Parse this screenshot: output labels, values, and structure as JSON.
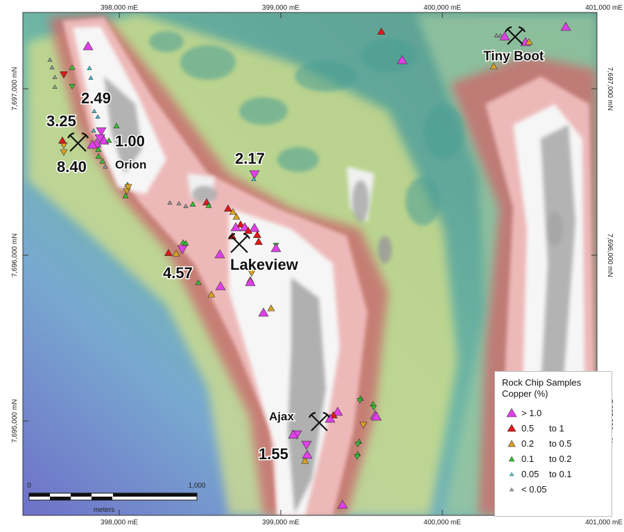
{
  "axes": {
    "top_ticks": [
      "398,000 mE",
      "399,000 mE",
      "400,000 mE",
      "401,000 mE"
    ],
    "bottom_ticks": [
      "398,000 mE",
      "399,000 mE",
      "400,000 mE",
      "401,000 mE"
    ],
    "left_ticks": [
      "7,697,000 mN",
      "7,696,000 mN",
      "7,695,000 mN"
    ],
    "right_ticks": [
      "7,697,000 mN",
      "7,696,000 mN",
      "7,695,000 mN"
    ]
  },
  "deposits": [
    {
      "name": "Orion"
    },
    {
      "name": "Lakeview"
    },
    {
      "name": "Tiny Boot"
    },
    {
      "name": "Ajax"
    }
  ],
  "values": [
    "2.49",
    "3.25",
    "1.00",
    "8.40",
    "2.17",
    "4.57",
    "1.55"
  ],
  "scalebar": {
    "start": "0",
    "end": "1,000",
    "unit": "meters"
  },
  "legend": {
    "title_line1": "Rock Chip Samples",
    "title_line2": "Copper (%)",
    "classes": [
      {
        "l1": "> 1.0",
        "l2": "",
        "color": "#e040e8"
      },
      {
        "l1": "0.5",
        "l2": "to 1",
        "color": "#e01818"
      },
      {
        "l1": "0.2",
        "l2": "to 0.5",
        "color": "#d8a020"
      },
      {
        "l1": "0.1",
        "l2": "to 0.2",
        "color": "#30c030"
      },
      {
        "l1": "0.05",
        "l2": "to 0.1",
        "color": "#40c8d8"
      },
      {
        "l1": "< 0.05",
        "l2": "",
        "color": "#a0a0a0"
      }
    ]
  },
  "colors": {
    "magnetic_high": "#f4f4f4",
    "magnetic_mid": "#e8a0a0",
    "magnetic_low": "#60b0a8",
    "background": "#7a88c8"
  }
}
